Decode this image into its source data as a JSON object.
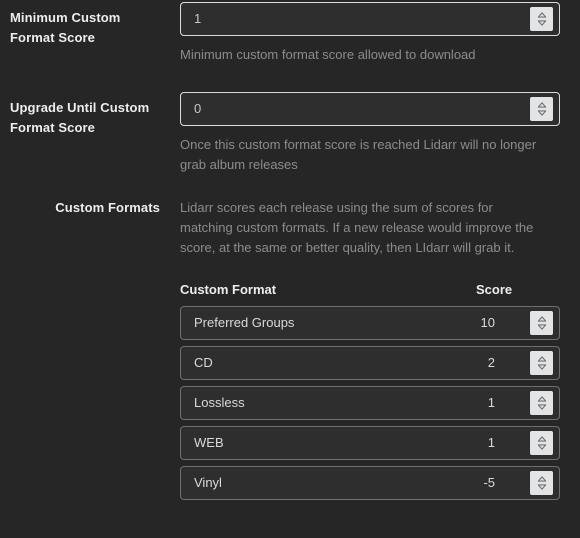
{
  "theme": {
    "page_background": "#262626",
    "field_background": "#2e2e2e",
    "field_border_focused": "#dcdcdc",
    "field_border": "#6f7071",
    "text_primary": "#eceded",
    "text_muted": "#8b8c8d",
    "spinner_background": "#e3e4e6"
  },
  "settings": {
    "minimum_custom_format_score": {
      "label_line1": "Minimum Custom",
      "label_line2": "Format Score",
      "value": "1",
      "help": "Minimum custom format score allowed to download",
      "spinner_icon": "spinner-up-down-icon"
    },
    "upgrade_until_custom_format_score": {
      "label_line1": "Upgrade Until Custom",
      "label_line2": "Format Score",
      "value": "0",
      "help": "Once this custom format score is reached Lidarr will no longer grab album releases",
      "spinner_icon": "spinner-up-down-icon"
    },
    "custom_formats": {
      "label": "Custom Formats",
      "help": "Lidarr scores each release using the sum of scores for matching custom formats. If a new release would improve the score, at the same or better quality, then LIdarr will grab it.",
      "columns": {
        "name": "Custom Format",
        "score": "Score"
      },
      "rows": [
        {
          "name": "Preferred Groups",
          "score": "10",
          "spinner_icon": "spinner-up-down-icon"
        },
        {
          "name": "CD",
          "score": "2",
          "spinner_icon": "spinner-up-down-icon"
        },
        {
          "name": "Lossless",
          "score": "1",
          "spinner_icon": "spinner-up-down-icon"
        },
        {
          "name": "WEB",
          "score": "1",
          "spinner_icon": "spinner-up-down-icon"
        },
        {
          "name": "Vinyl",
          "score": "-5",
          "spinner_icon": "spinner-up-down-icon"
        }
      ]
    }
  }
}
